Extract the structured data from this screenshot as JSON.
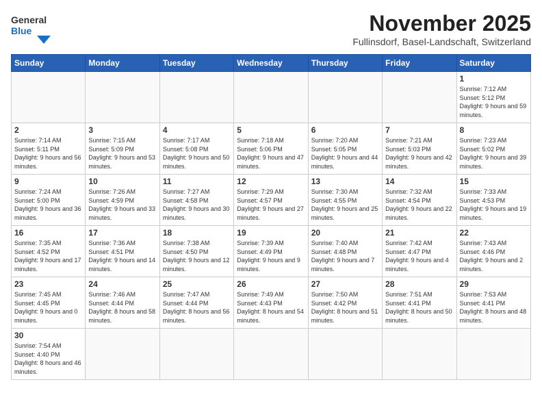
{
  "header": {
    "logo_general": "General",
    "logo_blue": "Blue",
    "month": "November 2025",
    "location": "Fullinsdorf, Basel-Landschaft, Switzerland"
  },
  "days_of_week": [
    "Sunday",
    "Monday",
    "Tuesday",
    "Wednesday",
    "Thursday",
    "Friday",
    "Saturday"
  ],
  "weeks": [
    [
      {
        "day": "",
        "info": ""
      },
      {
        "day": "",
        "info": ""
      },
      {
        "day": "",
        "info": ""
      },
      {
        "day": "",
        "info": ""
      },
      {
        "day": "",
        "info": ""
      },
      {
        "day": "",
        "info": ""
      },
      {
        "day": "1",
        "info": "Sunrise: 7:12 AM\nSunset: 5:12 PM\nDaylight: 9 hours and 59 minutes."
      }
    ],
    [
      {
        "day": "2",
        "info": "Sunrise: 7:14 AM\nSunset: 5:11 PM\nDaylight: 9 hours and 56 minutes."
      },
      {
        "day": "3",
        "info": "Sunrise: 7:15 AM\nSunset: 5:09 PM\nDaylight: 9 hours and 53 minutes."
      },
      {
        "day": "4",
        "info": "Sunrise: 7:17 AM\nSunset: 5:08 PM\nDaylight: 9 hours and 50 minutes."
      },
      {
        "day": "5",
        "info": "Sunrise: 7:18 AM\nSunset: 5:06 PM\nDaylight: 9 hours and 47 minutes."
      },
      {
        "day": "6",
        "info": "Sunrise: 7:20 AM\nSunset: 5:05 PM\nDaylight: 9 hours and 44 minutes."
      },
      {
        "day": "7",
        "info": "Sunrise: 7:21 AM\nSunset: 5:03 PM\nDaylight: 9 hours and 42 minutes."
      },
      {
        "day": "8",
        "info": "Sunrise: 7:23 AM\nSunset: 5:02 PM\nDaylight: 9 hours and 39 minutes."
      }
    ],
    [
      {
        "day": "9",
        "info": "Sunrise: 7:24 AM\nSunset: 5:00 PM\nDaylight: 9 hours and 36 minutes."
      },
      {
        "day": "10",
        "info": "Sunrise: 7:26 AM\nSunset: 4:59 PM\nDaylight: 9 hours and 33 minutes."
      },
      {
        "day": "11",
        "info": "Sunrise: 7:27 AM\nSunset: 4:58 PM\nDaylight: 9 hours and 30 minutes."
      },
      {
        "day": "12",
        "info": "Sunrise: 7:29 AM\nSunset: 4:57 PM\nDaylight: 9 hours and 27 minutes."
      },
      {
        "day": "13",
        "info": "Sunrise: 7:30 AM\nSunset: 4:55 PM\nDaylight: 9 hours and 25 minutes."
      },
      {
        "day": "14",
        "info": "Sunrise: 7:32 AM\nSunset: 4:54 PM\nDaylight: 9 hours and 22 minutes."
      },
      {
        "day": "15",
        "info": "Sunrise: 7:33 AM\nSunset: 4:53 PM\nDaylight: 9 hours and 19 minutes."
      }
    ],
    [
      {
        "day": "16",
        "info": "Sunrise: 7:35 AM\nSunset: 4:52 PM\nDaylight: 9 hours and 17 minutes."
      },
      {
        "day": "17",
        "info": "Sunrise: 7:36 AM\nSunset: 4:51 PM\nDaylight: 9 hours and 14 minutes."
      },
      {
        "day": "18",
        "info": "Sunrise: 7:38 AM\nSunset: 4:50 PM\nDaylight: 9 hours and 12 minutes."
      },
      {
        "day": "19",
        "info": "Sunrise: 7:39 AM\nSunset: 4:49 PM\nDaylight: 9 hours and 9 minutes."
      },
      {
        "day": "20",
        "info": "Sunrise: 7:40 AM\nSunset: 4:48 PM\nDaylight: 9 hours and 7 minutes."
      },
      {
        "day": "21",
        "info": "Sunrise: 7:42 AM\nSunset: 4:47 PM\nDaylight: 9 hours and 4 minutes."
      },
      {
        "day": "22",
        "info": "Sunrise: 7:43 AM\nSunset: 4:46 PM\nDaylight: 9 hours and 2 minutes."
      }
    ],
    [
      {
        "day": "23",
        "info": "Sunrise: 7:45 AM\nSunset: 4:45 PM\nDaylight: 9 hours and 0 minutes."
      },
      {
        "day": "24",
        "info": "Sunrise: 7:46 AM\nSunset: 4:44 PM\nDaylight: 8 hours and 58 minutes."
      },
      {
        "day": "25",
        "info": "Sunrise: 7:47 AM\nSunset: 4:44 PM\nDaylight: 8 hours and 56 minutes."
      },
      {
        "day": "26",
        "info": "Sunrise: 7:49 AM\nSunset: 4:43 PM\nDaylight: 8 hours and 54 minutes."
      },
      {
        "day": "27",
        "info": "Sunrise: 7:50 AM\nSunset: 4:42 PM\nDaylight: 8 hours and 51 minutes."
      },
      {
        "day": "28",
        "info": "Sunrise: 7:51 AM\nSunset: 4:41 PM\nDaylight: 8 hours and 50 minutes."
      },
      {
        "day": "29",
        "info": "Sunrise: 7:53 AM\nSunset: 4:41 PM\nDaylight: 8 hours and 48 minutes."
      }
    ],
    [
      {
        "day": "30",
        "info": "Sunrise: 7:54 AM\nSunset: 4:40 PM\nDaylight: 8 hours and 46 minutes."
      },
      {
        "day": "",
        "info": ""
      },
      {
        "day": "",
        "info": ""
      },
      {
        "day": "",
        "info": ""
      },
      {
        "day": "",
        "info": ""
      },
      {
        "day": "",
        "info": ""
      },
      {
        "day": "",
        "info": ""
      }
    ]
  ]
}
